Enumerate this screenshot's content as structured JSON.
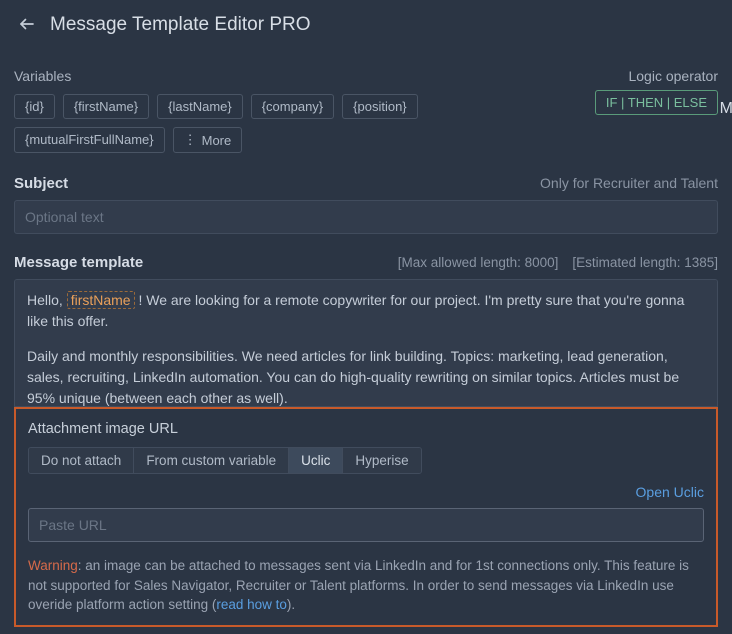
{
  "header": {
    "title": "Message Template Editor PRO"
  },
  "variables": {
    "label": "Variables",
    "chips": [
      "{id}",
      "{firstName}",
      "{lastName}",
      "{company}",
      "{position}"
    ],
    "chips2": [
      "{mutualFirstFullName}"
    ],
    "more_label": "More"
  },
  "logic": {
    "label": "Logic operator",
    "chip": "IF | THEN | ELSE"
  },
  "edge_char": "M",
  "subject": {
    "label": "Subject",
    "hint": "Only for Recruiter and Talent",
    "placeholder": "Optional text"
  },
  "template": {
    "label": "Message template",
    "max": "[Max allowed length: 8000]",
    "est": "[Estimated length: 1385]",
    "prefix": "Hello, ",
    "var_firstName": "firstName",
    "line1_rest": " ! We are looking for a remote copywriter for our project. I'm pretty sure that you're gonna like this offer.",
    "line2": "Daily and monthly responsibilities. We need articles for link building. Topics: marketing, lead generation, sales, recruiting, LinkedIn automation. You can do high-quality rewriting on similar topics. Articles must be 95% unique (between each other as well)."
  },
  "attach": {
    "title": "Attachment image URL",
    "segments": [
      "Do not attach",
      "From custom variable",
      "Uclic",
      "Hyperise"
    ],
    "active_index": 2,
    "open_link": "Open Uclic",
    "url_placeholder": "Paste URL",
    "warning_label": "Warning",
    "warning_text": ": an image can be attached to messages sent via LinkedIn and for 1st connections only. This feature is not supported for Sales Navigator, Recruiter or Talent platforms. In order to send messages via LinkedIn use overide platform action setting (",
    "read_link": "read how to",
    "warning_tail": ")."
  }
}
